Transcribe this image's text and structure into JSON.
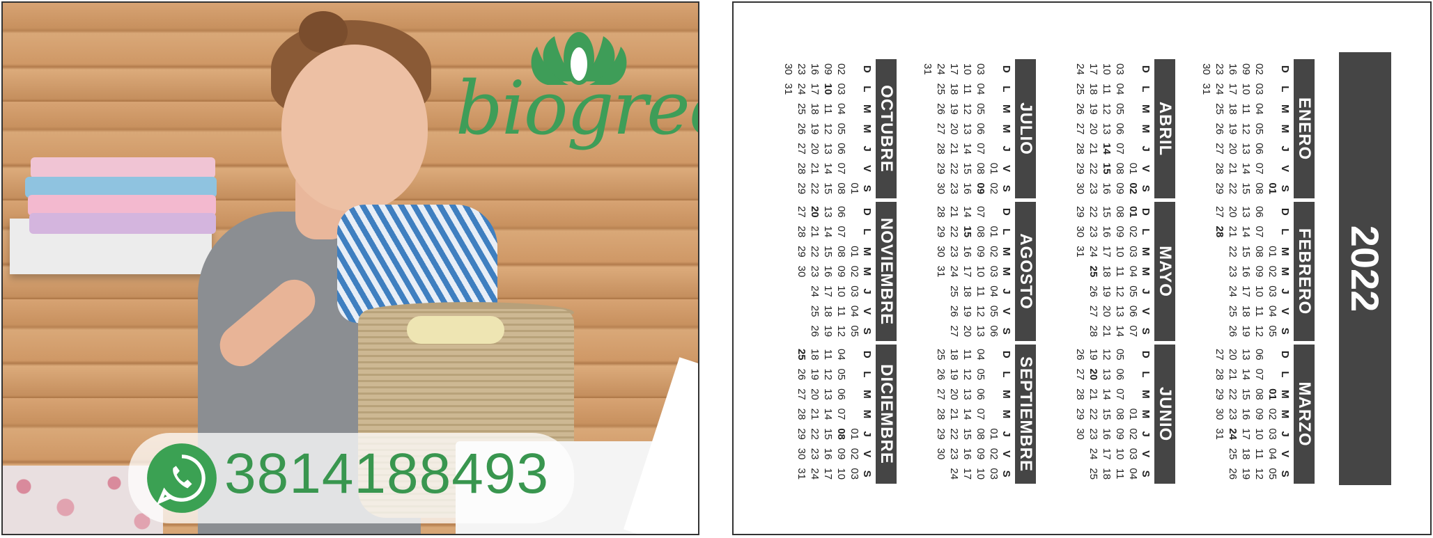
{
  "front": {
    "brand_name": "biogreen",
    "phone": "3814188493",
    "icons": {
      "logo": "lotus-logo-icon",
      "whatsapp": "whatsapp-icon"
    },
    "colors": {
      "brand_green": "#3e9d58",
      "whatsapp_green": "#3ba153"
    }
  },
  "calendar": {
    "year": "2022",
    "day_headers": [
      "D",
      "L",
      "M",
      "M",
      "J",
      "V",
      "S"
    ],
    "months": [
      {
        "name": "ENERO",
        "rows": [
          [
            "",
            "",
            "",
            "",
            "",
            "",
            "01"
          ],
          [
            "02",
            "03",
            "04",
            "05",
            "06",
            "07",
            "08"
          ],
          [
            "09",
            "10",
            "11",
            "12",
            "13",
            "14",
            "15"
          ],
          [
            "16",
            "17",
            "18",
            "19",
            "20",
            "21",
            "22"
          ],
          [
            "23",
            "24",
            "25",
            "26",
            "27",
            "28",
            "29"
          ],
          [
            "30",
            "31",
            "",
            "",
            "",
            "",
            ""
          ]
        ]
      },
      {
        "name": "FEBRERO",
        "rows": [
          [
            "",
            "",
            "01",
            "02",
            "03",
            "04",
            "05"
          ],
          [
            "06",
            "07",
            "08",
            "09",
            "10",
            "11",
            "12"
          ],
          [
            "13",
            "14",
            "15",
            "16",
            "17",
            "18",
            "19"
          ],
          [
            "20",
            "21",
            "22",
            "23",
            "24",
            "25",
            "26"
          ],
          [
            "27",
            "28",
            "",
            "",
            "",
            "",
            ""
          ]
        ]
      },
      {
        "name": "MARZO",
        "rows": [
          [
            "",
            "",
            "01",
            "02",
            "03",
            "04",
            "05"
          ],
          [
            "06",
            "07",
            "08",
            "09",
            "10",
            "11",
            "12"
          ],
          [
            "13",
            "14",
            "15",
            "16",
            "17",
            "18",
            "19"
          ],
          [
            "20",
            "21",
            "22",
            "23",
            "24",
            "25",
            "26"
          ],
          [
            "27",
            "28",
            "29",
            "30",
            "31",
            "",
            ""
          ]
        ]
      },
      {
        "name": "ABRIL",
        "rows": [
          [
            "",
            "",
            "",
            "",
            "",
            "01",
            "02"
          ],
          [
            "03",
            "04",
            "05",
            "06",
            "07",
            "08",
            "09"
          ],
          [
            "10",
            "11",
            "12",
            "13",
            "14",
            "15",
            "16"
          ],
          [
            "17",
            "18",
            "19",
            "20",
            "21",
            "22",
            "23"
          ],
          [
            "24",
            "25",
            "26",
            "27",
            "28",
            "29",
            "30"
          ]
        ]
      },
      {
        "name": "MAYO",
        "rows": [
          [
            "01",
            "02",
            "03",
            "04",
            "05",
            "06",
            "07"
          ],
          [
            "08",
            "09",
            "10",
            "11",
            "12",
            "13",
            "14"
          ],
          [
            "15",
            "16",
            "17",
            "18",
            "19",
            "20",
            "21"
          ],
          [
            "22",
            "23",
            "24",
            "25",
            "26",
            "27",
            "28"
          ],
          [
            "29",
            "30",
            "31",
            "",
            "",
            "",
            ""
          ]
        ]
      },
      {
        "name": "JUNIO",
        "rows": [
          [
            "",
            "",
            "",
            "01",
            "02",
            "03",
            "04"
          ],
          [
            "05",
            "06",
            "07",
            "08",
            "09",
            "10",
            "11"
          ],
          [
            "12",
            "13",
            "14",
            "15",
            "16",
            "17",
            "18"
          ],
          [
            "19",
            "20",
            "21",
            "22",
            "23",
            "24",
            "25"
          ],
          [
            "26",
            "27",
            "28",
            "29",
            "30",
            "",
            ""
          ]
        ]
      },
      {
        "name": "JULIO",
        "rows": [
          [
            "",
            "",
            "",
            "",
            "",
            "01",
            "02"
          ],
          [
            "03",
            "04",
            "05",
            "06",
            "07",
            "08",
            "09"
          ],
          [
            "10",
            "11",
            "12",
            "13",
            "14",
            "15",
            "16"
          ],
          [
            "17",
            "18",
            "19",
            "20",
            "21",
            "22",
            "23"
          ],
          [
            "24",
            "25",
            "26",
            "27",
            "28",
            "29",
            "30"
          ],
          [
            "31",
            "",
            "",
            "",
            "",
            "",
            ""
          ]
        ]
      },
      {
        "name": "AGOSTO",
        "rows": [
          [
            "",
            "01",
            "02",
            "03",
            "04",
            "05",
            "06"
          ],
          [
            "07",
            "08",
            "09",
            "10",
            "11",
            "12",
            "13"
          ],
          [
            "14",
            "15",
            "16",
            "17",
            "18",
            "19",
            "20"
          ],
          [
            "21",
            "22",
            "23",
            "24",
            "25",
            "26",
            "27"
          ],
          [
            "28",
            "29",
            "30",
            "31",
            "",
            "",
            ""
          ]
        ]
      },
      {
        "name": "SEPTIEMBRE",
        "rows": [
          [
            "",
            "",
            "",
            "",
            "01",
            "02",
            "03"
          ],
          [
            "04",
            "05",
            "06",
            "07",
            "08",
            "09",
            "10"
          ],
          [
            "11",
            "12",
            "13",
            "14",
            "15",
            "16",
            "17"
          ],
          [
            "18",
            "19",
            "20",
            "21",
            "22",
            "23",
            "24"
          ],
          [
            "25",
            "26",
            "27",
            "28",
            "29",
            "30",
            ""
          ]
        ]
      },
      {
        "name": "OCTUBRE",
        "rows": [
          [
            "",
            "",
            "",
            "",
            "",
            "",
            "01"
          ],
          [
            "02",
            "03",
            "04",
            "05",
            "06",
            "07",
            "08"
          ],
          [
            "09",
            "10",
            "11",
            "12",
            "13",
            "14",
            "15"
          ],
          [
            "16",
            "17",
            "18",
            "19",
            "20",
            "21",
            "22"
          ],
          [
            "23",
            "24",
            "25",
            "26",
            "27",
            "28",
            "29"
          ],
          [
            "30",
            "31",
            "",
            "",
            "",
            "",
            ""
          ]
        ]
      },
      {
        "name": "NOVIEMBRE",
        "rows": [
          [
            "",
            "",
            "01",
            "02",
            "03",
            "04",
            "05"
          ],
          [
            "06",
            "07",
            "08",
            "09",
            "10",
            "11",
            "12"
          ],
          [
            "13",
            "14",
            "15",
            "16",
            "17",
            "18",
            "19"
          ],
          [
            "20",
            "21",
            "22",
            "23",
            "24",
            "25",
            "26"
          ],
          [
            "27",
            "28",
            "29",
            "30",
            "",
            "",
            ""
          ]
        ]
      },
      {
        "name": "DICIEMBRE",
        "rows": [
          [
            "",
            "",
            "",
            "",
            "01",
            "02",
            "03"
          ],
          [
            "04",
            "05",
            "06",
            "07",
            "08",
            "09",
            "10"
          ],
          [
            "11",
            "12",
            "13",
            "14",
            "15",
            "16",
            "17"
          ],
          [
            "18",
            "19",
            "20",
            "21",
            "22",
            "23",
            "24"
          ],
          [
            "25",
            "26",
            "27",
            "28",
            "29",
            "30",
            "31"
          ]
        ]
      }
    ],
    "bold_days": [
      "ENERO-01",
      "FEBRERO-28",
      "MARZO-01",
      "MARZO-24",
      "ABRIL-02",
      "ABRIL-14",
      "ABRIL-15",
      "MAYO-01",
      "MAYO-25",
      "JUNIO-20",
      "JULIO-09",
      "AGOSTO-15",
      "OCTUBRE-10",
      "NOVIEMBRE-20",
      "DICIEMBRE-08",
      "DICIEMBRE-25"
    ]
  }
}
